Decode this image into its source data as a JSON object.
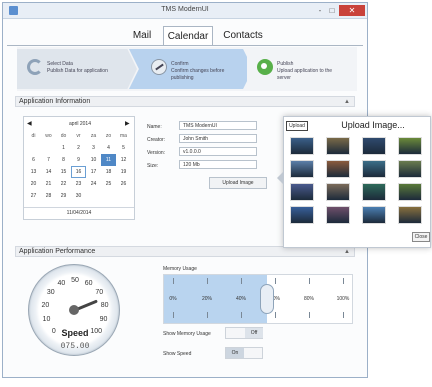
{
  "window": {
    "title": "TMS ModernUI",
    "controls": {
      "minimize": "-",
      "maximize": "□",
      "close": "✕"
    }
  },
  "tabs": [
    "Mail",
    "Calendar",
    "Contacts"
  ],
  "active_tab": "Calendar",
  "steps": [
    {
      "title": "Select Data",
      "text": "Publish Data for application"
    },
    {
      "title": "Confirm",
      "text": "Confirm changes before publishing"
    },
    {
      "title": "Publish",
      "text": "Upload application to the server"
    }
  ],
  "app_info": {
    "header": "Application Information",
    "calendar": {
      "month": "april 2014",
      "prev": "◀",
      "next": "▶",
      "weekdays": [
        "di",
        "wo",
        "do",
        "vr",
        "za",
        "zo",
        "ma"
      ],
      "weeks": [
        [
          "",
          "",
          "1",
          "2",
          "3",
          "4",
          "5"
        ],
        [
          "6",
          "7",
          "8",
          "9",
          "10",
          "11",
          "12"
        ],
        [
          "13",
          "14",
          "15",
          "16",
          "17",
          "18",
          "19"
        ],
        [
          "20",
          "21",
          "22",
          "23",
          "24",
          "25",
          "26"
        ],
        [
          "27",
          "28",
          "29",
          "30",
          "",
          "",
          ""
        ]
      ],
      "selected_day": "11",
      "today_day": "16",
      "footer": "11/04/2014"
    },
    "form": {
      "name_label": "Name:",
      "name_value": "TMS ModernUI",
      "creator_label": "Creator:",
      "creator_value": "John Smith",
      "version_label": "Version:",
      "version_value": "v1.0.0.0",
      "size_label": "Size:",
      "size_value": "120 Mb",
      "upload_button": "Upload Image"
    }
  },
  "upload_popup": {
    "button": "Upload",
    "title": "Upload Image...",
    "close": "Close",
    "thumb_colors": [
      "#3b5f8a",
      "#7a6a48",
      "#2f4a6e",
      "#6b8a3a",
      "#5c7fa8",
      "#8a5a3c",
      "#3c6e88",
      "#6a7c4e",
      "#4a5a8e",
      "#7b6b5a",
      "#2e6a5a",
      "#5a7a3a",
      "#385f9a",
      "#6f4f6a",
      "#4b7fb2",
      "#88703e"
    ]
  },
  "performance": {
    "header": "Application Performance",
    "gauge": {
      "labels": [
        "0",
        "10",
        "20",
        "30",
        "40",
        "50",
        "60",
        "70",
        "80",
        "90",
        "100"
      ],
      "title": "Speed",
      "value_text": "075.00",
      "value": 75
    },
    "memory": {
      "title": "Memory Usage",
      "ticks": [
        "0%",
        "20%",
        "40%",
        "60%",
        "80%",
        "100%"
      ],
      "value_percent": 55
    },
    "show_memory": {
      "label": "Show Memory Usage",
      "state": "Off"
    },
    "show_speed": {
      "label": "Show Speed",
      "state": "On"
    }
  }
}
